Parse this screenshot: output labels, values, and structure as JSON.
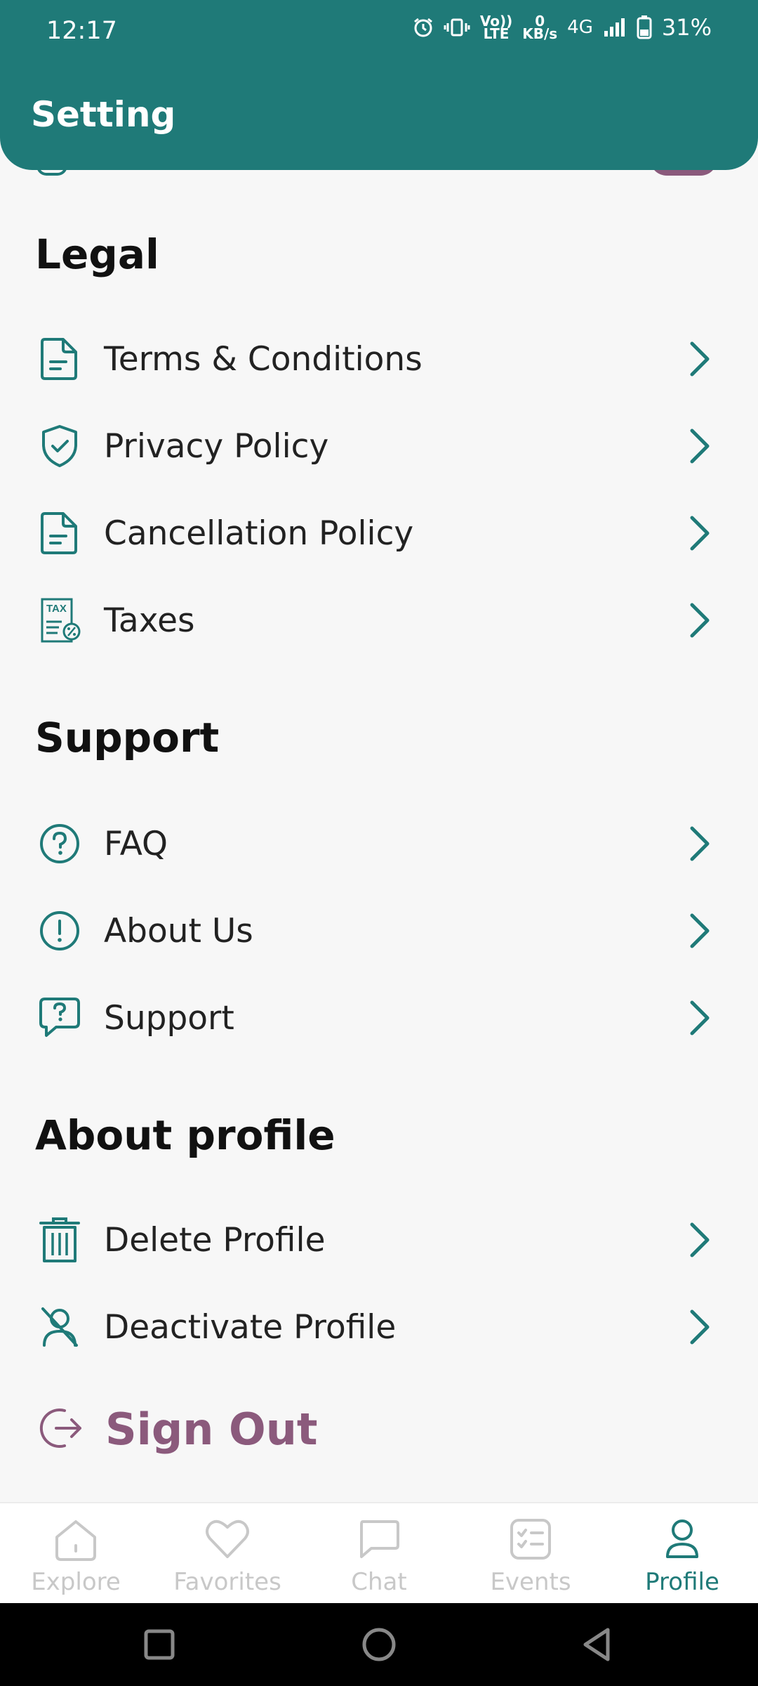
{
  "status_bar": {
    "time": "12:17",
    "volte_line1": "Vo))",
    "volte_line2": "LTE",
    "speed_value": "0",
    "speed_unit": "KB/s",
    "network": "4G",
    "battery": "31%"
  },
  "header": {
    "title": "Setting"
  },
  "sections": {
    "legal": {
      "title": "Legal",
      "items": [
        {
          "label": "Terms & Conditions",
          "icon": "document-icon"
        },
        {
          "label": "Privacy Policy",
          "icon": "shield-check-icon"
        },
        {
          "label": "Cancellation Policy",
          "icon": "document-icon"
        },
        {
          "label": "Taxes",
          "icon": "tax-icon",
          "icon_text": "TAX"
        }
      ]
    },
    "support": {
      "title": "Support",
      "items": [
        {
          "label": "FAQ",
          "icon": "question-circle-icon"
        },
        {
          "label": "About Us",
          "icon": "info-circle-icon"
        },
        {
          "label": "Support",
          "icon": "question-chat-icon"
        }
      ]
    },
    "about_profile": {
      "title": "About profile",
      "items": [
        {
          "label": "Delete Profile",
          "icon": "trash-icon"
        },
        {
          "label": "Deactivate Profile",
          "icon": "user-off-icon"
        }
      ]
    }
  },
  "sign_out": {
    "label": "Sign Out",
    "icon": "logout-icon"
  },
  "tab_bar": {
    "tabs": [
      {
        "label": "Explore",
        "icon": "home-icon",
        "active": false
      },
      {
        "label": "Favorites",
        "icon": "heart-icon",
        "active": false
      },
      {
        "label": "Chat",
        "icon": "chat-icon",
        "active": false
      },
      {
        "label": "Events",
        "icon": "checklist-icon",
        "active": false
      },
      {
        "label": "Profile",
        "icon": "user-icon",
        "active": true
      }
    ]
  },
  "colors": {
    "primary": "#1f7a78",
    "accent": "#8b5a7c",
    "inactive": "#c8c8c8",
    "background": "#f7f7f7"
  }
}
